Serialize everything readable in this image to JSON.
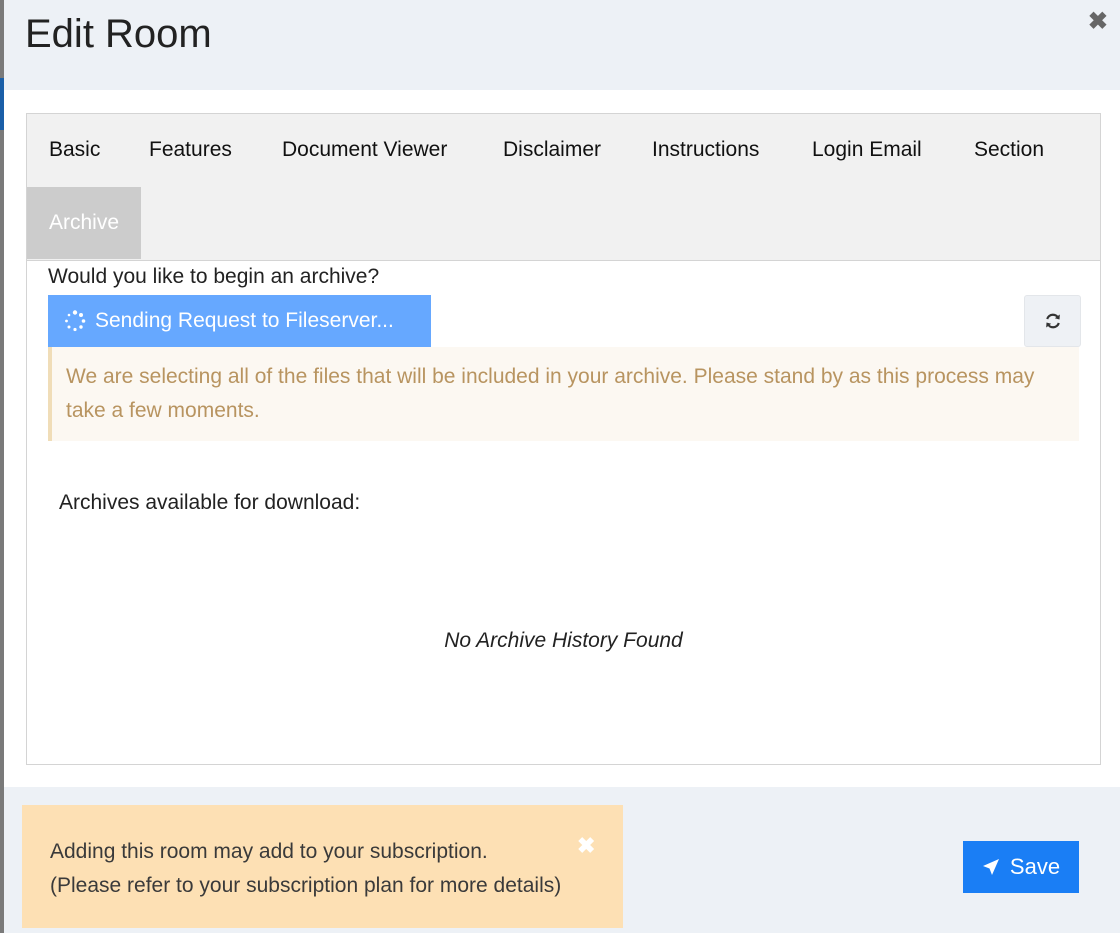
{
  "modal": {
    "title": "Edit Room",
    "close_icon": "close-icon"
  },
  "tabs": [
    {
      "label": "Basic",
      "active": false
    },
    {
      "label": "Features",
      "active": false
    },
    {
      "label": "Document Viewer",
      "active": false
    },
    {
      "label": "Disclaimer",
      "active": false
    },
    {
      "label": "Instructions",
      "active": false
    },
    {
      "label": "Login Email",
      "active": false
    },
    {
      "label": "Section",
      "active": false
    },
    {
      "label": "Archive",
      "active": true
    }
  ],
  "archive": {
    "question": "Would you like to begin an archive?",
    "sending_label": "Sending Request to Fileserver...",
    "spinner_icon": "spinner-icon",
    "refresh_icon": "refresh-icon",
    "alert_text": "We are selecting all of the files that will be included in your archive. Please stand by as this process may take a few moments.",
    "available_label": "Archives available for download:",
    "empty_text": "No Archive History Found"
  },
  "footer": {
    "subscription_line1": "Adding this room may add to your subscription.",
    "subscription_line2": "(Please refer to your subscription plan for more details)",
    "save_label": "Save",
    "save_icon": "send-icon"
  },
  "colors": {
    "accent": "#1a7ef5",
    "sending_button": "#66a8ff",
    "alert_text": "#b89460",
    "subscription_bg": "#fde0b4"
  }
}
